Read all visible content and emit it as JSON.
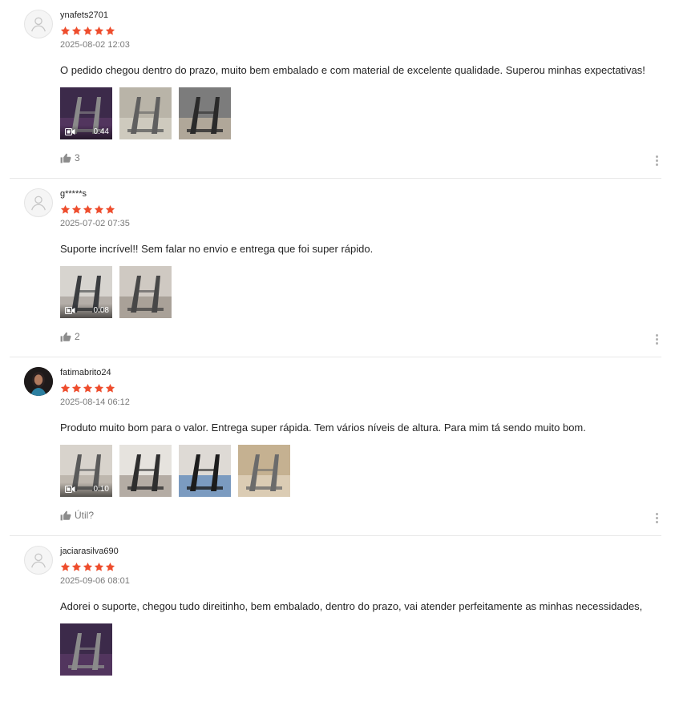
{
  "colors": {
    "star": "#ee4d2d",
    "muted": "#8c8c8c"
  },
  "reviews": [
    {
      "username": "ynafets2701",
      "avatar": "default-avatar",
      "rating": 5,
      "date": "2025-08-02 12:03",
      "text": "O pedido chegou dentro do prazo, muito bem embalado e com material de excelente qualidade. Superou minhas expectativas!",
      "media": [
        {
          "kind": "video",
          "duration": "0:44"
        },
        {
          "kind": "image"
        },
        {
          "kind": "image"
        }
      ],
      "likes": "3"
    },
    {
      "username": "g*****s",
      "avatar": "default-avatar",
      "rating": 5,
      "date": "2025-07-02 07:35",
      "text": "Suporte incrível!! Sem falar no envio e entrega que foi super rápido.",
      "media": [
        {
          "kind": "video",
          "duration": "0:08"
        },
        {
          "kind": "image"
        }
      ],
      "likes": "2"
    },
    {
      "username": "fatimabrito24",
      "avatar": "photo-avatar",
      "rating": 5,
      "date": "2025-08-14 06:12",
      "text": "Produto muito bom para o valor. Entrega super rápida. Tem vários níveis de altura. Para mim tá sendo muito bom.",
      "media": [
        {
          "kind": "video",
          "duration": "0:10"
        },
        {
          "kind": "image"
        },
        {
          "kind": "image"
        },
        {
          "kind": "image"
        }
      ],
      "likes": "Útil?"
    },
    {
      "username": "jaciarasilva690",
      "avatar": "default-avatar",
      "rating": 5,
      "date": "2025-09-06 08:01",
      "text": "Adorei o suporte, chegou tudo direitinho, bem embalado, dentro do prazo, vai atender perfeitamente as minhas necessidades,",
      "media": [
        {
          "kind": "image"
        }
      ],
      "likes": ""
    }
  ]
}
